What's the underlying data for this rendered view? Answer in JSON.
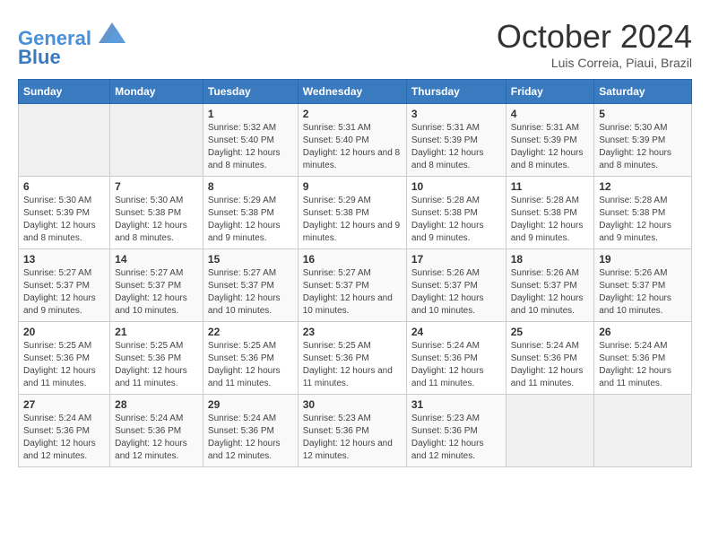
{
  "logo": {
    "line1": "General",
    "line2": "Blue"
  },
  "title": "October 2024",
  "subtitle": "Luis Correia, Piaui, Brazil",
  "days_header": [
    "Sunday",
    "Monday",
    "Tuesday",
    "Wednesday",
    "Thursday",
    "Friday",
    "Saturday"
  ],
  "weeks": [
    [
      {
        "day": "",
        "info": ""
      },
      {
        "day": "",
        "info": ""
      },
      {
        "day": "1",
        "info": "Sunrise: 5:32 AM\nSunset: 5:40 PM\nDaylight: 12 hours and 8 minutes."
      },
      {
        "day": "2",
        "info": "Sunrise: 5:31 AM\nSunset: 5:40 PM\nDaylight: 12 hours and 8 minutes."
      },
      {
        "day": "3",
        "info": "Sunrise: 5:31 AM\nSunset: 5:39 PM\nDaylight: 12 hours and 8 minutes."
      },
      {
        "day": "4",
        "info": "Sunrise: 5:31 AM\nSunset: 5:39 PM\nDaylight: 12 hours and 8 minutes."
      },
      {
        "day": "5",
        "info": "Sunrise: 5:30 AM\nSunset: 5:39 PM\nDaylight: 12 hours and 8 minutes."
      }
    ],
    [
      {
        "day": "6",
        "info": "Sunrise: 5:30 AM\nSunset: 5:39 PM\nDaylight: 12 hours and 8 minutes."
      },
      {
        "day": "7",
        "info": "Sunrise: 5:30 AM\nSunset: 5:38 PM\nDaylight: 12 hours and 8 minutes."
      },
      {
        "day": "8",
        "info": "Sunrise: 5:29 AM\nSunset: 5:38 PM\nDaylight: 12 hours and 9 minutes."
      },
      {
        "day": "9",
        "info": "Sunrise: 5:29 AM\nSunset: 5:38 PM\nDaylight: 12 hours and 9 minutes."
      },
      {
        "day": "10",
        "info": "Sunrise: 5:28 AM\nSunset: 5:38 PM\nDaylight: 12 hours and 9 minutes."
      },
      {
        "day": "11",
        "info": "Sunrise: 5:28 AM\nSunset: 5:38 PM\nDaylight: 12 hours and 9 minutes."
      },
      {
        "day": "12",
        "info": "Sunrise: 5:28 AM\nSunset: 5:38 PM\nDaylight: 12 hours and 9 minutes."
      }
    ],
    [
      {
        "day": "13",
        "info": "Sunrise: 5:27 AM\nSunset: 5:37 PM\nDaylight: 12 hours and 9 minutes."
      },
      {
        "day": "14",
        "info": "Sunrise: 5:27 AM\nSunset: 5:37 PM\nDaylight: 12 hours and 10 minutes."
      },
      {
        "day": "15",
        "info": "Sunrise: 5:27 AM\nSunset: 5:37 PM\nDaylight: 12 hours and 10 minutes."
      },
      {
        "day": "16",
        "info": "Sunrise: 5:27 AM\nSunset: 5:37 PM\nDaylight: 12 hours and 10 minutes."
      },
      {
        "day": "17",
        "info": "Sunrise: 5:26 AM\nSunset: 5:37 PM\nDaylight: 12 hours and 10 minutes."
      },
      {
        "day": "18",
        "info": "Sunrise: 5:26 AM\nSunset: 5:37 PM\nDaylight: 12 hours and 10 minutes."
      },
      {
        "day": "19",
        "info": "Sunrise: 5:26 AM\nSunset: 5:37 PM\nDaylight: 12 hours and 10 minutes."
      }
    ],
    [
      {
        "day": "20",
        "info": "Sunrise: 5:25 AM\nSunset: 5:36 PM\nDaylight: 12 hours and 11 minutes."
      },
      {
        "day": "21",
        "info": "Sunrise: 5:25 AM\nSunset: 5:36 PM\nDaylight: 12 hours and 11 minutes."
      },
      {
        "day": "22",
        "info": "Sunrise: 5:25 AM\nSunset: 5:36 PM\nDaylight: 12 hours and 11 minutes."
      },
      {
        "day": "23",
        "info": "Sunrise: 5:25 AM\nSunset: 5:36 PM\nDaylight: 12 hours and 11 minutes."
      },
      {
        "day": "24",
        "info": "Sunrise: 5:24 AM\nSunset: 5:36 PM\nDaylight: 12 hours and 11 minutes."
      },
      {
        "day": "25",
        "info": "Sunrise: 5:24 AM\nSunset: 5:36 PM\nDaylight: 12 hours and 11 minutes."
      },
      {
        "day": "26",
        "info": "Sunrise: 5:24 AM\nSunset: 5:36 PM\nDaylight: 12 hours and 11 minutes."
      }
    ],
    [
      {
        "day": "27",
        "info": "Sunrise: 5:24 AM\nSunset: 5:36 PM\nDaylight: 12 hours and 12 minutes."
      },
      {
        "day": "28",
        "info": "Sunrise: 5:24 AM\nSunset: 5:36 PM\nDaylight: 12 hours and 12 minutes."
      },
      {
        "day": "29",
        "info": "Sunrise: 5:24 AM\nSunset: 5:36 PM\nDaylight: 12 hours and 12 minutes."
      },
      {
        "day": "30",
        "info": "Sunrise: 5:23 AM\nSunset: 5:36 PM\nDaylight: 12 hours and 12 minutes."
      },
      {
        "day": "31",
        "info": "Sunrise: 5:23 AM\nSunset: 5:36 PM\nDaylight: 12 hours and 12 minutes."
      },
      {
        "day": "",
        "info": ""
      },
      {
        "day": "",
        "info": ""
      }
    ]
  ]
}
